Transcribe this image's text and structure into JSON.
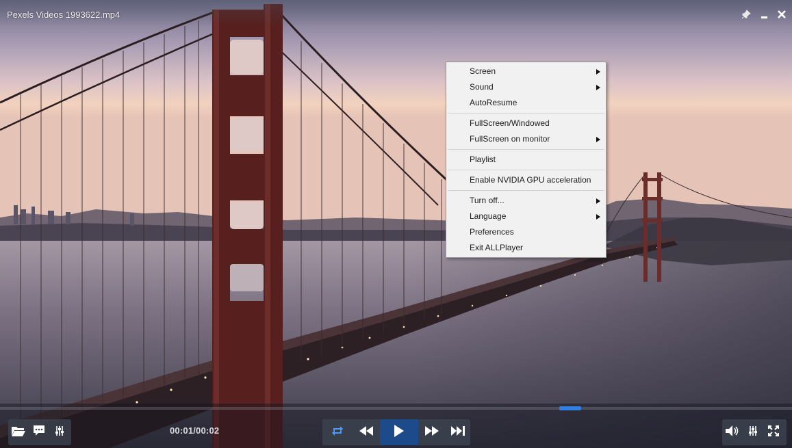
{
  "window": {
    "title": "Pexels Videos 1993622.mp4"
  },
  "context_menu": {
    "groups": [
      [
        {
          "label": "Screen",
          "submenu": true
        },
        {
          "label": "Sound",
          "submenu": true
        },
        {
          "label": "AutoResume",
          "submenu": false
        }
      ],
      [
        {
          "label": "FullScreen/Windowed",
          "submenu": false
        },
        {
          "label": "FullScreen on monitor",
          "submenu": true
        }
      ],
      [
        {
          "label": "Playlist",
          "submenu": false
        }
      ],
      [
        {
          "label": "Enable NVIDIA GPU acceleration",
          "submenu": false
        }
      ],
      [
        {
          "label": "Turn off...",
          "submenu": true
        },
        {
          "label": "Language",
          "submenu": true
        },
        {
          "label": "Preferences",
          "submenu": false
        },
        {
          "label": "Exit ALLPlayer",
          "submenu": false
        }
      ]
    ]
  },
  "playback": {
    "time": "00:01/00:02",
    "progress": 0.72
  },
  "icons": {
    "window": [
      "pin-icon",
      "minimize-icon",
      "close-icon"
    ],
    "left": [
      "open-folder-icon",
      "subtitles-icon",
      "equalizer-icon"
    ],
    "center": [
      "repeat-icon",
      "rewind-icon",
      "play-icon",
      "fast-forward-icon",
      "skip-next-icon"
    ],
    "right": [
      "volume-icon",
      "audio-settings-icon",
      "fullscreen-icon"
    ]
  },
  "colors": {
    "accent": "#2f7fe0",
    "play_button": "#1c4a8a",
    "menu_background": "#f1f1f1"
  }
}
